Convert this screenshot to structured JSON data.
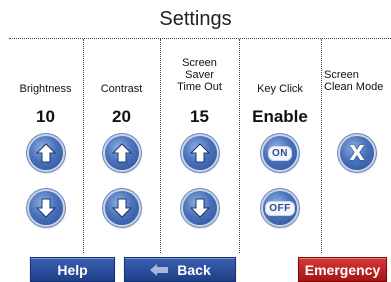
{
  "title": "Settings",
  "columns": [
    {
      "label": "Brightness",
      "value": "10"
    },
    {
      "label": "Contrast",
      "value": "20"
    },
    {
      "label": "Screen\nSaver\nTime Out",
      "value": "15"
    },
    {
      "label": "Key Click",
      "value": "Enable",
      "on_label": "ON",
      "off_label": "OFF"
    },
    {
      "label": "Screen\nClean Mode",
      "clean_label": "X"
    }
  ],
  "footer": {
    "help_label": "Help",
    "back_label": "Back",
    "emergency_label": "Emergency"
  },
  "colors": {
    "button_blue": "#2a4f96",
    "emergency_red": "#c02020"
  }
}
